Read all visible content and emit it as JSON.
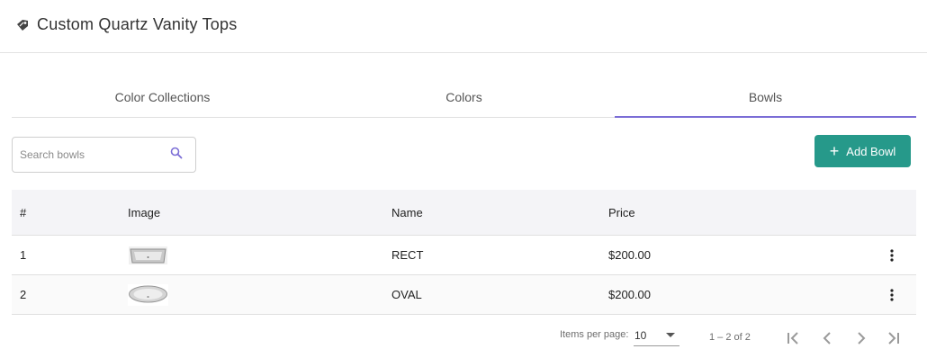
{
  "header": {
    "title": "Custom Quartz Vanity Tops",
    "logo_icon": "gem-tag-icon"
  },
  "tabs": [
    {
      "label": "Color Collections",
      "active": false
    },
    {
      "label": "Colors",
      "active": false
    },
    {
      "label": "Bowls",
      "active": true
    }
  ],
  "search": {
    "placeholder": "Search bowls",
    "value": ""
  },
  "toolbar": {
    "add_label": "Add Bowl"
  },
  "table": {
    "columns": [
      "#",
      "Image",
      "Name",
      "Price"
    ],
    "rows": [
      {
        "num": "1",
        "image": "rectangular-bowl-thumbnail",
        "name": "RECT",
        "price": "$200.00"
      },
      {
        "num": "2",
        "image": "oval-bowl-thumbnail",
        "name": "OVAL",
        "price": "$200.00"
      }
    ]
  },
  "paginator": {
    "items_per_page_label": "Items per page:",
    "items_per_page_value": "10",
    "range_label": "1 – 2 of 2"
  },
  "colors": {
    "accent": "#7b6dd6",
    "primary_button": "#26998a"
  }
}
